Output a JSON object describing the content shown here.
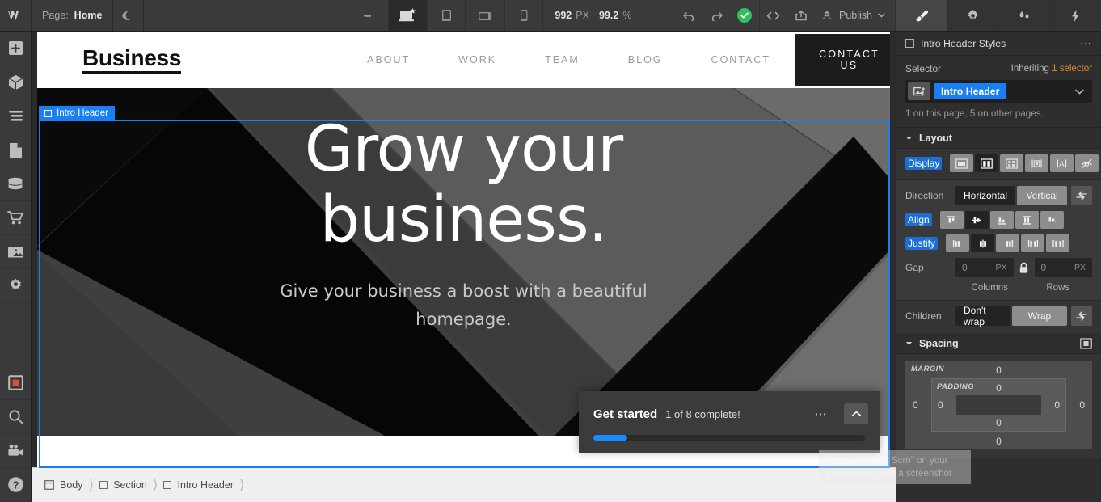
{
  "topbar": {
    "logo": "webflow-logo-icon",
    "page_label": "Page:",
    "page_value": "Home",
    "preview_icon": "eye-preview-icon",
    "more_icon": "kebab-menu-icon",
    "breakpoints": [
      {
        "name": "desktop-breakpoint",
        "icon": "desktop-star-icon",
        "active": true
      },
      {
        "name": "tablet-breakpoint",
        "icon": "tablet-icon",
        "active": false
      },
      {
        "name": "mobile-landscape-breakpoint",
        "icon": "mobile-landscape-icon",
        "active": false
      },
      {
        "name": "mobile-portrait-breakpoint",
        "icon": "mobile-portrait-icon",
        "active": false
      }
    ],
    "canvas_width": "992",
    "canvas_width_unit": "PX",
    "zoom_value": "99.2",
    "zoom_unit": "%",
    "undo_icon": "undo-icon",
    "redo_icon": "redo-icon",
    "saved_icon": "saved-check-icon",
    "code_icon": "code-brackets-icon",
    "export_icon": "share-export-icon",
    "rocket_icon": "rocket-icon",
    "publish_label": "Publish",
    "publish_caret": "chevron-down-icon",
    "panel_tabs": [
      {
        "name": "tab-style",
        "icon": "paintbrush-icon",
        "active": true
      },
      {
        "name": "tab-settings",
        "icon": "gear-icon",
        "active": false
      },
      {
        "name": "tab-interactions",
        "icon": "water-drops-icon",
        "active": false
      },
      {
        "name": "tab-effects",
        "icon": "lightning-bolt-icon",
        "active": false
      }
    ]
  },
  "leftbar": {
    "items": [
      {
        "name": "sidebar-add-elements",
        "icon": "plus-icon"
      },
      {
        "name": "sidebar-components",
        "icon": "cube-icon"
      },
      {
        "name": "sidebar-navigator",
        "icon": "layers-lines-icon"
      },
      {
        "name": "sidebar-pages",
        "icon": "page-icon"
      },
      {
        "name": "sidebar-cms",
        "icon": "database-icon"
      },
      {
        "name": "sidebar-ecommerce",
        "icon": "shopping-cart-icon"
      },
      {
        "name": "sidebar-assets",
        "icon": "images-icon"
      },
      {
        "name": "sidebar-settings",
        "icon": "gear-icon"
      }
    ],
    "bottom_items": [
      {
        "name": "sidebar-recording",
        "icon": "record-square-icon"
      },
      {
        "name": "sidebar-search",
        "icon": "search-icon"
      },
      {
        "name": "sidebar-video",
        "icon": "video-camera-icon"
      },
      {
        "name": "sidebar-help",
        "icon": "help-question-icon"
      }
    ]
  },
  "canvas": {
    "element_badge": {
      "label": "Intro Header",
      "icon": "div-block-icon"
    },
    "site": {
      "brand": "Business",
      "nav_links": [
        "ABOUT",
        "WORK",
        "TEAM",
        "BLOG",
        "CONTACT"
      ],
      "cta_label": "CONTACT US",
      "hero_heading_line1": "Grow your",
      "hero_heading_line2": "business.",
      "hero_subtext": "Give your business a boost with a beautiful homepage."
    }
  },
  "breadcrumbs": [
    {
      "label": "Body",
      "icon": "body-icon"
    },
    {
      "label": "Section",
      "icon": "section-icon"
    },
    {
      "label": "Intro Header",
      "icon": "div-block-icon"
    }
  ],
  "right_panel": {
    "header": {
      "title": "Intro Header Styles",
      "checkbox_icon": "div-block-icon",
      "more_icon": "ellipsis-icon"
    },
    "selector": {
      "label": "Selector",
      "inherit_prefix": "Inheriting",
      "inherit_link": "1 selector",
      "chip": "Intro Header",
      "chip_icon": "element-thumb-icon",
      "caret_icon": "chevron-down-icon",
      "usage_note": "1 on this page, 5 on other pages."
    },
    "layout": {
      "section_title": "Layout",
      "display_label": "Display",
      "display_options": [
        {
          "name": "display-block",
          "icon": "block-icon",
          "active": false
        },
        {
          "name": "display-flex",
          "icon": "flex-icon",
          "active": true
        },
        {
          "name": "display-grid",
          "icon": "grid-icon",
          "active": false
        },
        {
          "name": "display-inline-block",
          "icon": "inline-block-icon",
          "active": false
        },
        {
          "name": "display-inline",
          "icon": "inline-text-icon",
          "active": false
        },
        {
          "name": "display-none",
          "icon": "hidden-slash-icon",
          "active": false
        }
      ],
      "direction_label": "Direction",
      "direction_options": [
        {
          "label": "Horizontal",
          "active": true
        },
        {
          "label": "Vertical",
          "active": false
        }
      ],
      "direction_reverse_icon": "reverse-arrow-icon",
      "align_label": "Align",
      "align_options": [
        {
          "name": "align-start",
          "active": false
        },
        {
          "name": "align-center",
          "active": true
        },
        {
          "name": "align-end",
          "active": false
        },
        {
          "name": "align-stretch",
          "active": false
        },
        {
          "name": "align-baseline",
          "active": false
        }
      ],
      "justify_label": "Justify",
      "justify_options": [
        {
          "name": "justify-start",
          "active": false
        },
        {
          "name": "justify-center",
          "active": true
        },
        {
          "name": "justify-end",
          "active": false
        },
        {
          "name": "justify-space-between",
          "active": false
        },
        {
          "name": "justify-space-around",
          "active": false
        }
      ],
      "gap_label": "Gap",
      "gap_columns_value": "0",
      "gap_columns_unit": "PX",
      "gap_rows_value": "0",
      "gap_rows_unit": "PX",
      "gap_lock_icon": "lock-icon",
      "gap_columns_sublabel": "Columns",
      "gap_rows_sublabel": "Rows",
      "children_label": "Children",
      "children_options": [
        {
          "label": "Don't wrap",
          "active": true
        },
        {
          "label": "Wrap",
          "active": false
        }
      ],
      "children_reverse_icon": "reverse-arrow-icon"
    },
    "spacing": {
      "section_title": "Spacing",
      "expand_icon": "spacing-expand-icon",
      "margin_label": "MARGIN",
      "padding_label": "PADDING",
      "margin_top": "0",
      "margin_right": "0",
      "margin_bottom": "0",
      "margin_left": "0",
      "padding_top": "0",
      "padding_right": "0",
      "padding_bottom": "0",
      "padding_left": "0"
    }
  },
  "get_started": {
    "title": "Get started",
    "progress_text": "1 of 8 complete!",
    "more_icon": "ellipsis-icon",
    "collapse_icon": "chevron-up-icon",
    "progress_percent": 12.5
  },
  "screenshot_tip": {
    "text": "Press the \"Prnt Scrn\" on your keyboard to take a screenshot"
  },
  "colors": {
    "accent_blue": "#1a7ef5",
    "inherit_orange": "#d98b2b",
    "saved_green": "#2fbf5c",
    "panel_bg": "#2e2e2e"
  }
}
